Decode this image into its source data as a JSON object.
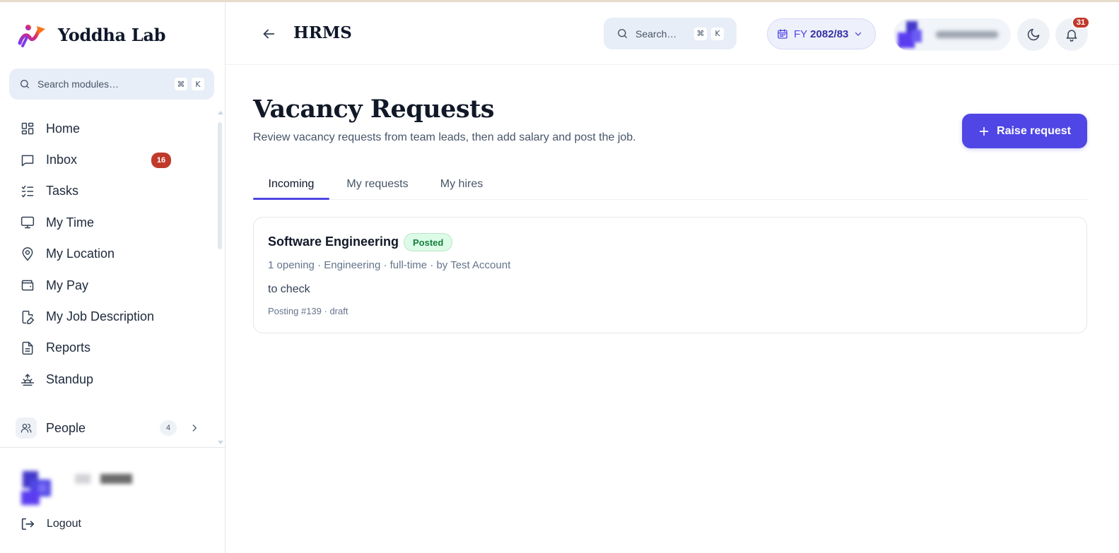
{
  "app": {
    "brand": "Yoddha Lab"
  },
  "sidebar": {
    "search_placeholder": "Search modules…",
    "shortcut_cmd": "⌘",
    "shortcut_key": "K",
    "items": [
      {
        "label": "Home",
        "icon": "grid-icon"
      },
      {
        "label": "Inbox",
        "icon": "message-icon",
        "badge": "16"
      },
      {
        "label": "Tasks",
        "icon": "checklist-icon"
      },
      {
        "label": "My Time",
        "icon": "monitor-icon"
      },
      {
        "label": "My Location",
        "icon": "map-pin-icon"
      },
      {
        "label": "My Pay",
        "icon": "wallet-icon"
      },
      {
        "label": "My Job Description",
        "icon": "file-edit-icon"
      },
      {
        "label": "Reports",
        "icon": "document-icon"
      },
      {
        "label": "Standup",
        "icon": "sunrise-icon"
      }
    ],
    "people": {
      "label": "People",
      "count": "4"
    },
    "logout": "Logout"
  },
  "header": {
    "title": "HRMS",
    "search_placeholder": "Search…",
    "shortcut_cmd": "⌘",
    "shortcut_key": "K",
    "fy_prefix": "FY",
    "fy_value": "2082/83",
    "notifications": "31"
  },
  "main": {
    "title": "Vacancy Requests",
    "subtitle": "Review vacancy requests from team leads, then add salary and post the job.",
    "raise_button": "Raise request",
    "tabs": [
      {
        "label": "Incoming",
        "active": true
      },
      {
        "label": "My requests",
        "active": false
      },
      {
        "label": "My hires",
        "active": false
      }
    ],
    "requests": [
      {
        "title": "Software Engineering",
        "status": "Posted",
        "meta": "1 opening · Engineering · full-time · by Test Account",
        "note": "to check",
        "posting": "Posting #139 · draft"
      }
    ]
  },
  "colors": {
    "accent": "#4f46e5",
    "badge_red": "#c0392b",
    "posted_green": "#15803d",
    "search_bg": "#e8eef7"
  }
}
